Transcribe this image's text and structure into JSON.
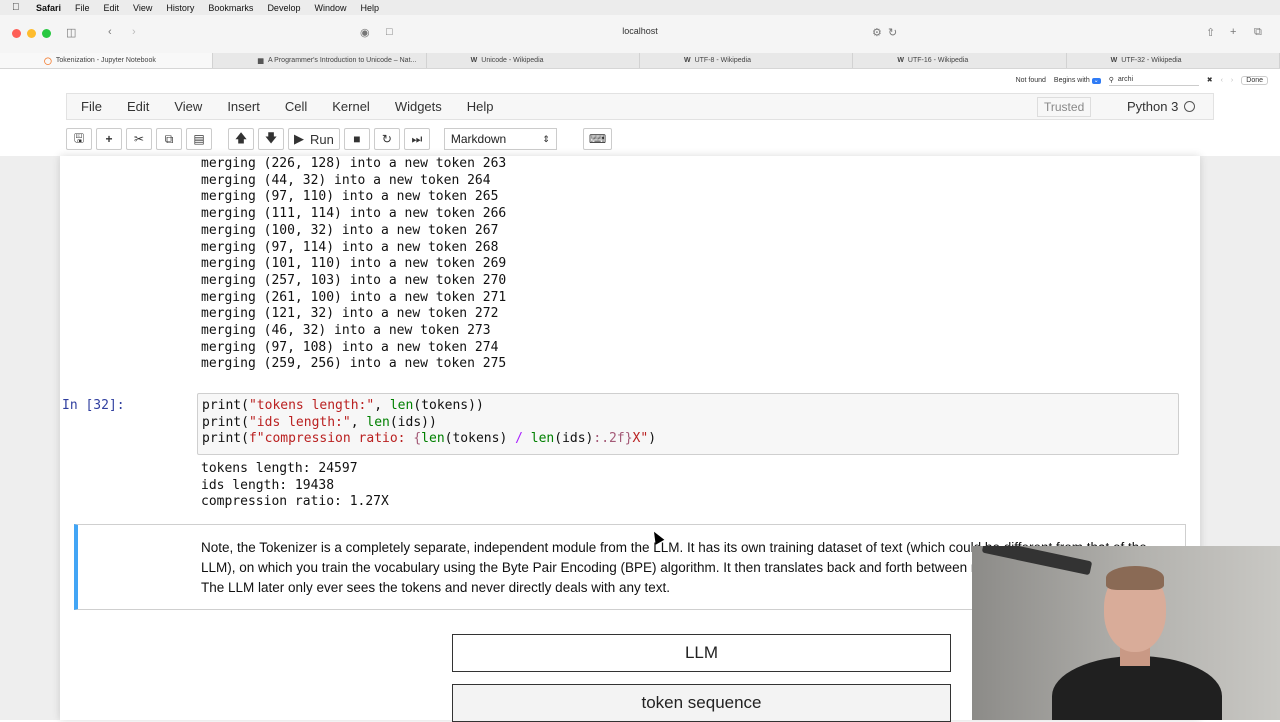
{
  "menubar": {
    "app": "Safari",
    "items": [
      "File",
      "Edit",
      "View",
      "History",
      "Bookmarks",
      "Develop",
      "Window",
      "Help"
    ]
  },
  "browser": {
    "url": "localhost",
    "tabs": [
      {
        "label": "Tokenization - Jupyter Notebook",
        "icon": "jupyter-icon",
        "active": true
      },
      {
        "label": "A Programmer's Introduction to Unicode – Nat...",
        "icon": "page-icon",
        "active": false
      },
      {
        "label": "Unicode - Wikipedia",
        "icon": "wikipedia-icon",
        "active": false
      },
      {
        "label": "UTF-8 - Wikipedia",
        "icon": "wikipedia-icon",
        "active": false
      },
      {
        "label": "UTF-16 - Wikipedia",
        "icon": "wikipedia-icon",
        "active": false
      },
      {
        "label": "UTF-32 - Wikipedia",
        "icon": "wikipedia-icon",
        "active": false
      }
    ],
    "find": {
      "status": "Not found",
      "mode": "Begins with",
      "query": "archi",
      "done": "Done"
    }
  },
  "jupyter": {
    "menu": [
      "File",
      "Edit",
      "View",
      "Insert",
      "Cell",
      "Kernel",
      "Widgets",
      "Help"
    ],
    "trusted": "Trusted",
    "kernel": "Python 3",
    "toolbar": {
      "run": "Run",
      "cell_type": "Markdown"
    }
  },
  "notebook": {
    "merge_lines": [
      "merging (226, 128) into a new token 263",
      "merging (44, 32) into a new token 264",
      "merging (97, 110) into a new token 265",
      "merging (111, 114) into a new token 266",
      "merging (100, 32) into a new token 267",
      "merging (97, 114) into a new token 268",
      "merging (101, 110) into a new token 269",
      "merging (257, 103) into a new token 270",
      "merging (261, 100) into a new token 271",
      "merging (121, 32) into a new token 272",
      "merging (46, 32) into a new token 273",
      "merging (97, 108) into a new token 274",
      "merging (259, 256) into a new token 275"
    ],
    "cell_prompt": "In [32]:",
    "code": {
      "l1_fn": "print",
      "l1_a": "(",
      "l1_s": "\"tokens length:\"",
      "l1_b": ", ",
      "l1_len": "len",
      "l1_c": "(tokens))",
      "l2_fn": "print",
      "l2_a": "(",
      "l2_s": "\"ids length:\"",
      "l2_b": ", ",
      "l2_len": "len",
      "l2_c": "(ids))",
      "l3_fn": "print",
      "l3_a": "(",
      "l3_s1": "f\"compression ratio: ",
      "l3_b1": "{",
      "l3_len1": "len",
      "l3_c1": "(tokens) ",
      "l3_op": "/",
      "l3_d": " ",
      "l3_len2": "len",
      "l3_e": "(ids)",
      "l3_fmt": ":.2f",
      "l3_b2": "}",
      "l3_s2": "X\"",
      "l3_f": ")"
    },
    "outputs": [
      "tokens length: 24597",
      "ids length: 19438",
      "compression ratio: 1.27X"
    ],
    "markdown": "Note, the Tokenizer is a completely separate, independent module from the LLM. It has its own training dataset of text (which could be different from that of the LLM), on which you train the vocabulary using the Byte Pair Encoding (BPE) algorithm. It then translates back and forth between raw text and sequences of tokens. The LLM later only ever sees the tokens and never directly deals with any text.",
    "diagram": {
      "box1": "LLM",
      "box2": "token sequence"
    }
  }
}
